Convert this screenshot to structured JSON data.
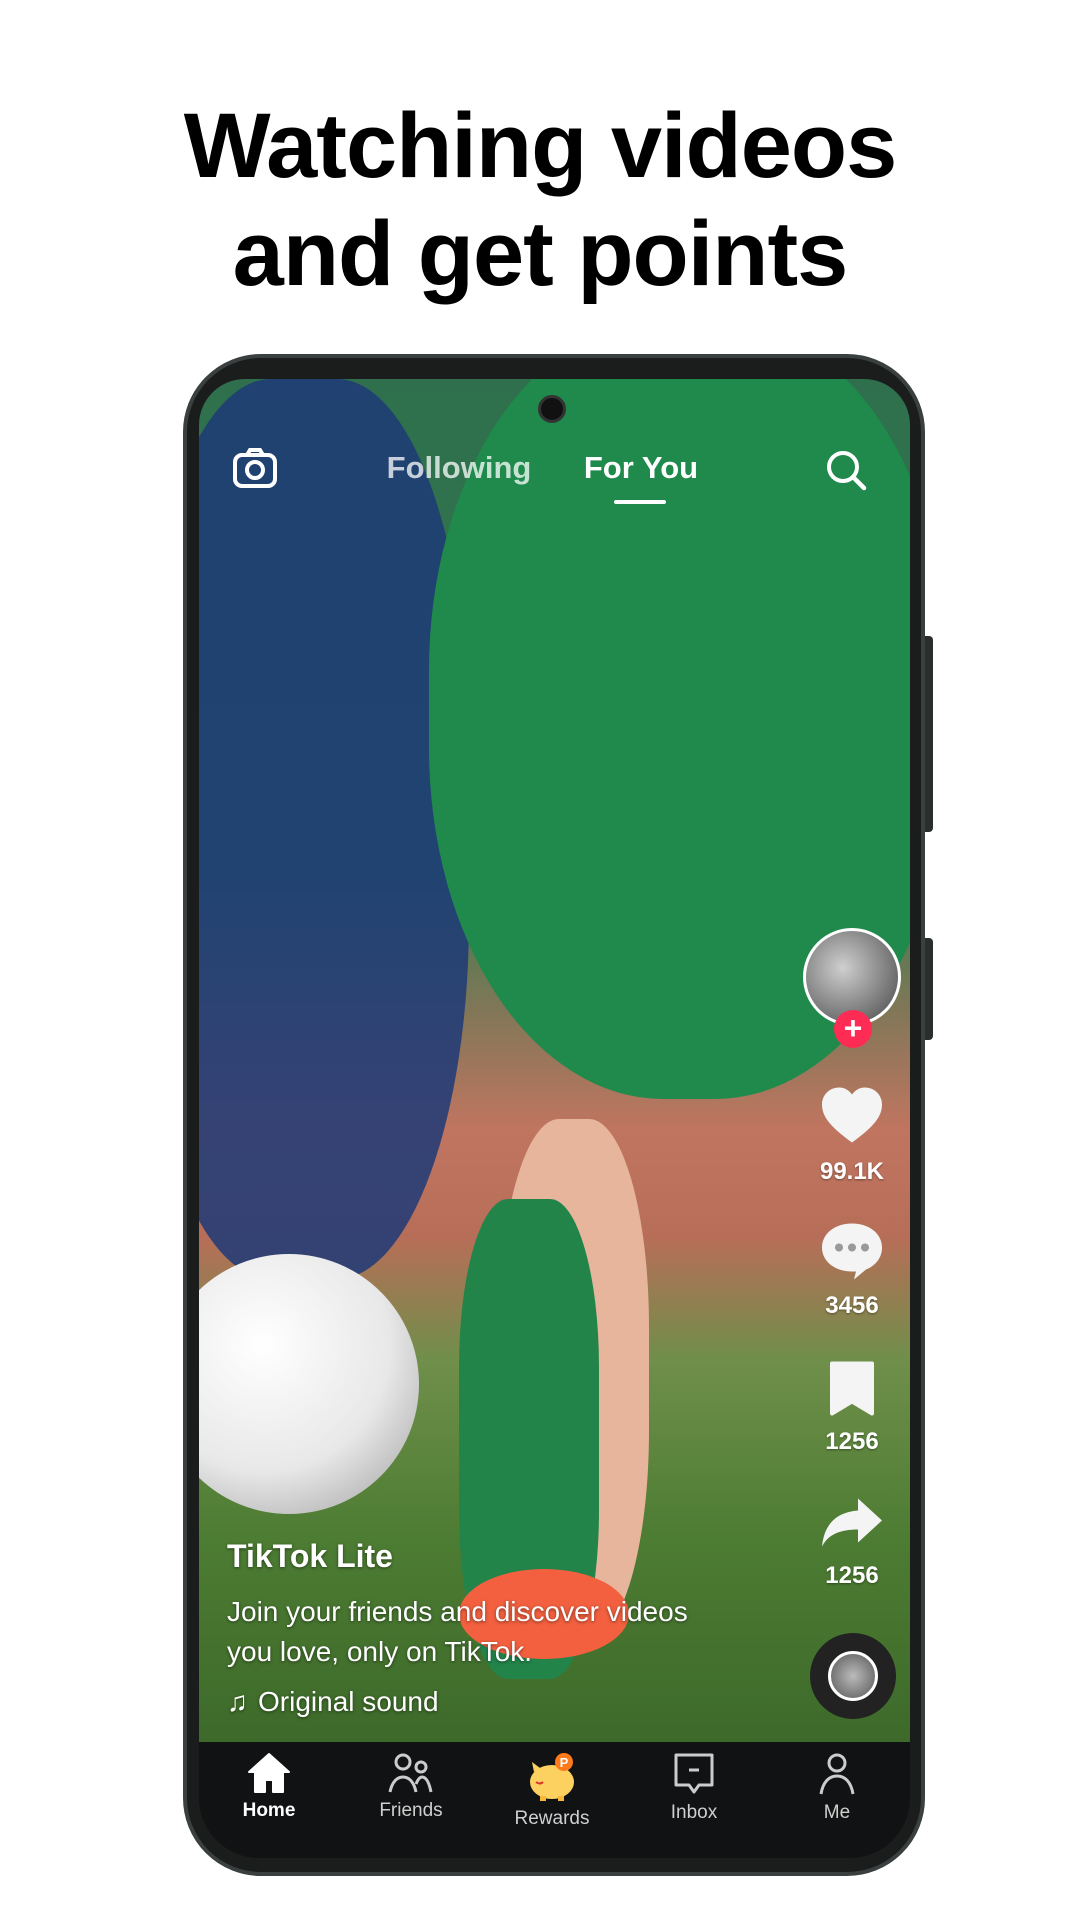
{
  "headline": {
    "line1": "Watching videos",
    "line2": "and get points"
  },
  "top_bar": {
    "tabs": [
      {
        "label": "Following"
      },
      {
        "label": "For You",
        "active": true
      }
    ],
    "camera_icon": "camera-icon",
    "search_icon": "search-icon"
  },
  "rail": {
    "like_count": "99.1K",
    "comment_count": "3456",
    "bookmark_count": "1256",
    "share_count": "1256",
    "follow_color": "#fe2c55"
  },
  "caption": {
    "author": "TikTok Lite",
    "line1": "Join your friends and discover videos",
    "line2": "you love, only on TikTok.",
    "sound": "Original sound"
  },
  "nav": {
    "items": [
      {
        "label": "Home",
        "icon": "home-icon",
        "active": true
      },
      {
        "label": "Friends",
        "icon": "friends-icon"
      },
      {
        "label": "Rewards",
        "icon": "piggy-bank-icon"
      },
      {
        "label": "Inbox",
        "icon": "inbox-icon"
      },
      {
        "label": "Me",
        "icon": "profile-icon"
      }
    ]
  }
}
